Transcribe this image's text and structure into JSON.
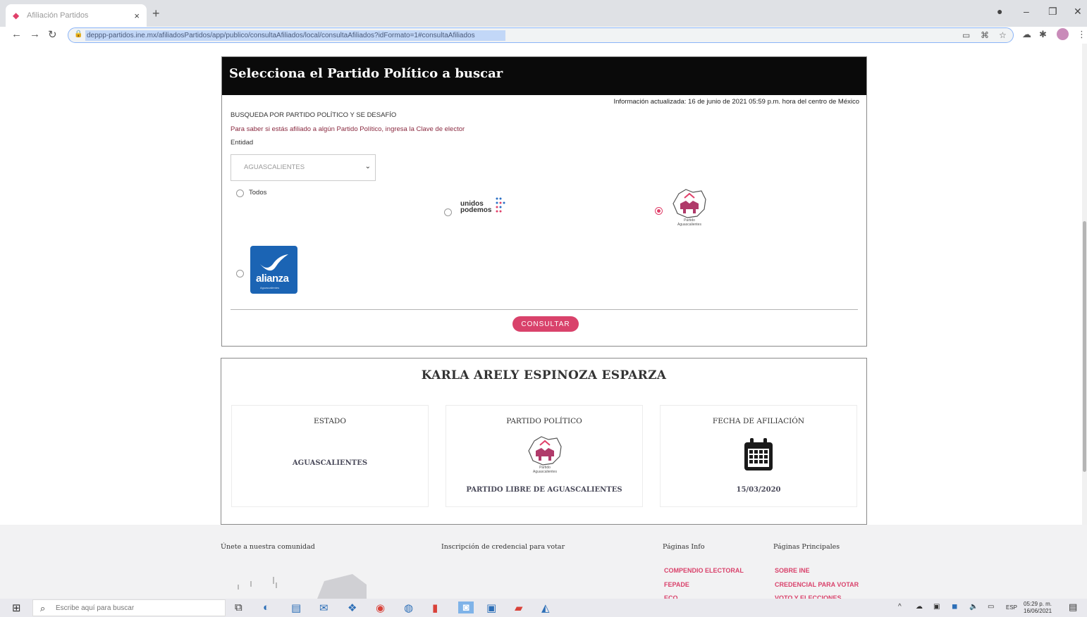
{
  "browser": {
    "tab_title": "Afiliación Partidos",
    "url": "deppp-partidos.ine.mx/afiliadosPartidos/app/publico/consultaAfiliados/local/consultaAfiliados?idFormato=1#consultaAfiliados",
    "new_tab": "+",
    "close_tab": "×",
    "win_min": "–",
    "win_max": "❐",
    "win_close": "✕"
  },
  "search": {
    "header_title": "Selecciona el Partido Político a buscar",
    "info_updated": "Información actualizada: 16 de junio de 2021 05:59 p.m. hora del centro de México",
    "section_title": "BUSQUEDA POR PARTIDO POLÍTICO Y SE DESAFÍO",
    "instructions": "Para saber si estás afiliado a algún Partido Político, ingresa la Clave de elector",
    "entity_label": "Entidad",
    "entity_value": "AGUASCALIENTES",
    "option_all": "Todos",
    "logo_unidos_line1": "unidos",
    "logo_unidos_line2": "podemos",
    "logo_alianza": "alianza",
    "logo_alianza_sub": "Aguascalientes",
    "logo_pla_line1": "Partido",
    "logo_pla_line2": "Aguascalientes",
    "submit": "CONSULTAR"
  },
  "result": {
    "name": "KARLA ARELY ESPINOZA ESPARZA",
    "state_header": "ESTADO",
    "state_value": "AGUASCALIENTES",
    "party_header": "PARTIDO POLÍTICO",
    "party_value": "PARTIDO LIBRE DE AGUASCALIENTES",
    "date_header": "FECHA DE AFILIACIÓN",
    "date_value": "15/03/2020"
  },
  "footer": {
    "col1": "Únete a nuestra comunidad",
    "col2": "Inscripción de credencial para votar",
    "col3": "Páginas Info",
    "col4": "Páginas Principales",
    "links_a": [
      "COMPENDIO ELECTORAL",
      "FEPADE",
      "ECO"
    ],
    "links_b": [
      "SOBRE INE",
      "CREDENCIAL PARA VOTAR",
      "VOTO Y ELECCIONES"
    ]
  },
  "taskbar": {
    "search_placeholder": "Escribe aquí para buscar",
    "lang": "ESP",
    "time": "05:29 p. m.",
    "date": "16/06/2021"
  },
  "colors": {
    "accent": "#d9426b",
    "header_bg": "#0a0a0a",
    "alianza_blue": "#1b64b4"
  }
}
